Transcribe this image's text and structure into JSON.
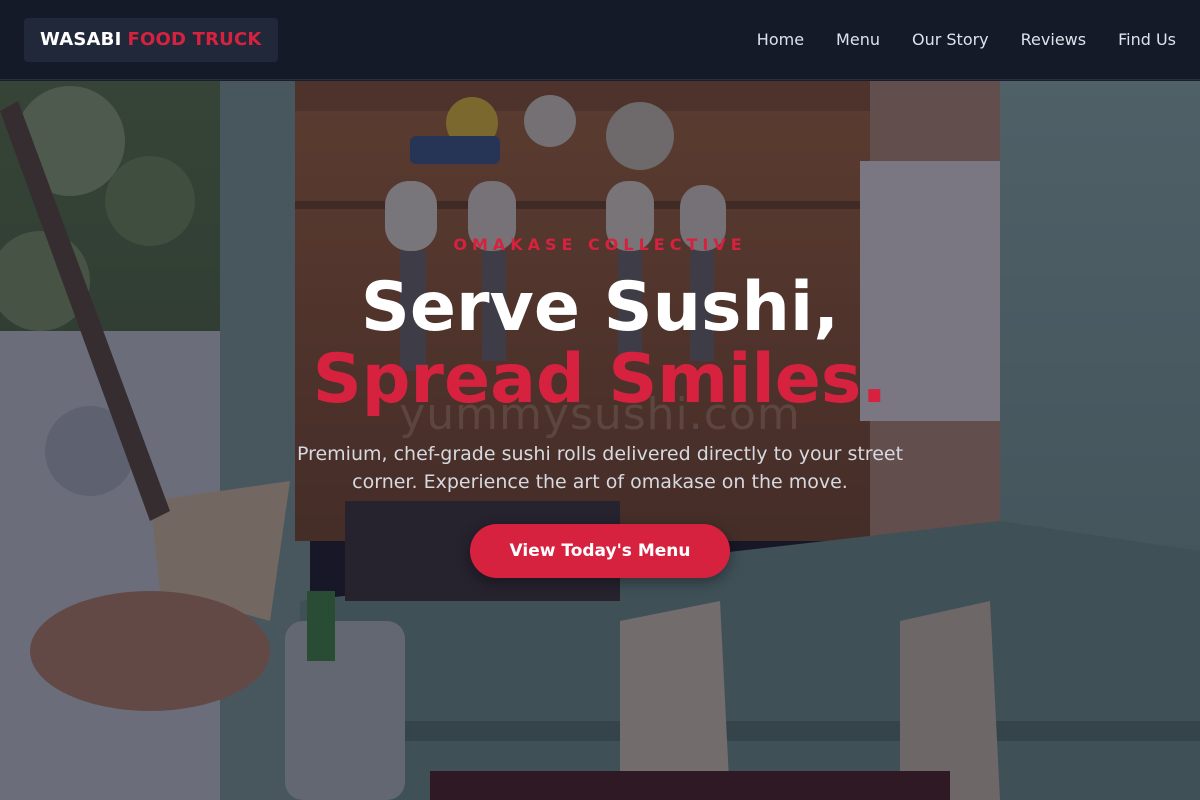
{
  "brand": {
    "part1": "WASABI",
    "part2": "FOOD TRUCK"
  },
  "nav": {
    "items": [
      {
        "label": "Home"
      },
      {
        "label": "Menu"
      },
      {
        "label": "Our Story"
      },
      {
        "label": "Reviews"
      },
      {
        "label": "Find Us"
      }
    ]
  },
  "hero": {
    "kicker": "OMAKASE COLLECTIVE",
    "headline_line1": "Serve Sushi,",
    "headline_line2": "Spread Smiles.",
    "subtext": "Premium, chef-grade sushi rolls delivered directly to your street corner. Experience the art of omakase on the move.",
    "cta_label": "View Today's Menu",
    "watermark": "yummysushi.com"
  },
  "colors": {
    "accent": "#d7223f",
    "nav_bg": "#151a28",
    "text_light": "#ffffff"
  }
}
